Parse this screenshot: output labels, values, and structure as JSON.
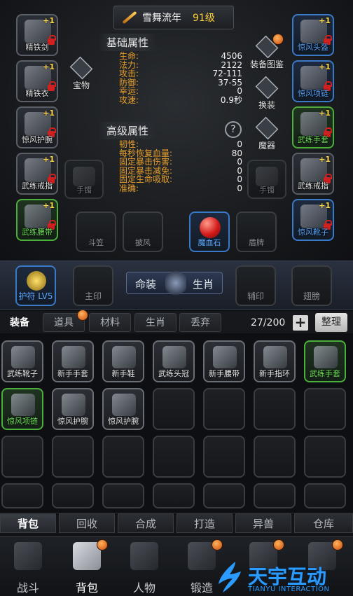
{
  "header": {
    "name": "雪舞流年",
    "level": "91级"
  },
  "sections": {
    "basic": "基础属性",
    "advanced": "高级属性"
  },
  "basic_stats": [
    {
      "name": "生命:",
      "value": "4506"
    },
    {
      "name": "法力:",
      "value": "2122"
    },
    {
      "name": "攻击:",
      "value": "72-111"
    },
    {
      "name": "防御:",
      "value": "37-55"
    },
    {
      "name": "幸运:",
      "value": "0"
    },
    {
      "name": "攻速:",
      "value": "0.9秒"
    }
  ],
  "advanced_stats": [
    {
      "name": "韧性:",
      "value": "0"
    },
    {
      "name": "每秒恢复血量:",
      "value": "80"
    },
    {
      "name": "固定暴击伤害:",
      "value": "0"
    },
    {
      "name": "固定暴击减免:",
      "value": "0"
    },
    {
      "name": "固定生命吸取:",
      "value": "0"
    },
    {
      "name": "准确:",
      "value": "0"
    }
  ],
  "left_slots": [
    {
      "label": "精铁剑",
      "badge": "+1",
      "locked": true,
      "rarity": "normal"
    },
    {
      "label": "精铁衣",
      "badge": "+1",
      "locked": true,
      "rarity": "normal"
    },
    {
      "label": "惊风护腕",
      "badge": "+1",
      "locked": true,
      "rarity": "normal"
    },
    {
      "label": "武练戒指",
      "badge": "+1",
      "locked": true,
      "rarity": "normal"
    },
    {
      "label": "武练腰带",
      "badge": "+1",
      "locked": true,
      "rarity": "green"
    }
  ],
  "right_slots": [
    {
      "label": "惊风头盔",
      "badge": "+1",
      "locked": true,
      "rarity": "blue"
    },
    {
      "label": "惊风项链",
      "badge": "+1",
      "locked": true,
      "rarity": "blue"
    },
    {
      "label": "武练手套",
      "badge": "+1",
      "locked": true,
      "rarity": "green"
    },
    {
      "label": "武练戒指",
      "badge": "+1",
      "locked": true,
      "rarity": "normal"
    },
    {
      "label": "惊风靴子",
      "badge": "+1",
      "locked": true,
      "rarity": "blue"
    }
  ],
  "center_buttons": {
    "treasure": "宝物",
    "codex": "装备图鉴",
    "swap": "换装",
    "demon": "魔器",
    "help": "?"
  },
  "extra_slots": {
    "bracelet_left": "手镯",
    "bracelet_right": "手镯"
  },
  "bottom_slots": [
    {
      "label": "斗笠"
    },
    {
      "label": "披风"
    },
    {
      "label": "魔血石"
    },
    {
      "label": "盾牌"
    }
  ],
  "mid_bar": {
    "guardian": "护符 LV5",
    "seal": "主印",
    "mingzhuang_left": "命装",
    "mingzhuang_right": "生肖",
    "aux_seal": "辅印",
    "wings": "翅膀"
  },
  "bag_tabs": [
    "装备",
    "道具",
    "材料",
    "生肖",
    "丢弃"
  ],
  "bag_count": "27/200",
  "plus_btn": "+",
  "sort_btn": "整理",
  "bag_items": [
    {
      "label": "武练靴子",
      "rarity": "normal"
    },
    {
      "label": "新手手套",
      "rarity": "normal"
    },
    {
      "label": "新手鞋",
      "rarity": "normal"
    },
    {
      "label": "武练头冠",
      "rarity": "normal"
    },
    {
      "label": "新手腰带",
      "rarity": "normal"
    },
    {
      "label": "新手指环",
      "rarity": "normal"
    },
    {
      "label": "武练手套",
      "rarity": "green"
    },
    {
      "label": "惊风项链",
      "rarity": "green"
    },
    {
      "label": "惊风护腕",
      "rarity": "normal"
    },
    {
      "label": "惊风护腕",
      "rarity": "normal"
    }
  ],
  "sub_tabs": [
    "背包",
    "回收",
    "合成",
    "打造",
    "异兽",
    "仓库"
  ],
  "nav": [
    "战斗",
    "背包",
    "人物",
    "锻造",
    "",
    ""
  ],
  "watermark": {
    "main": "天宇互动",
    "sub": "TIANYU INTERACTION"
  },
  "colors": {
    "gold": "#ffcf3a",
    "stat_name": "#e8a02a",
    "blue_rarity": "#5aa8ff",
    "green_rarity": "#6fe05a",
    "lock": "#d02020"
  }
}
